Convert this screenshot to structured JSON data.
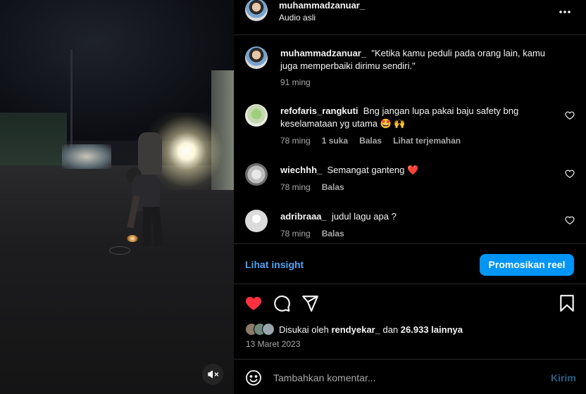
{
  "header": {
    "username": "muhammadzanuar_",
    "audio": "Audio asli",
    "more_icon": "more-horizontal-icon"
  },
  "caption": {
    "username": "muhammadzanuar_",
    "text": "\"Ketika kamu peduli pada orang lain, kamu juga memperbaiki dirimu sendiri.\"",
    "time": "91 ming"
  },
  "comments": [
    {
      "username": "refofaris_rangkuti",
      "text": "Bng jangan lupa pakai baju safety bng keselamataan yg utama 🤩 🙌",
      "time": "78 ming",
      "likes": "1 suka",
      "reply": "Balas",
      "translate": "Lihat terjemahan"
    },
    {
      "username": "wiechhh_",
      "text": "Semangat ganteng ❤️",
      "time": "78 ming",
      "reply": "Balas"
    },
    {
      "username": "adribraaa_",
      "text": "judul lagu apa ?",
      "time": "78 ming",
      "reply": "Balas"
    }
  ],
  "insight": {
    "link": "Lihat insight",
    "promote": "Promosikan reel"
  },
  "likes": {
    "prefix": "Disukai oleh",
    "user": "rendyekar_",
    "and": "dan",
    "count": "26.933 lainnya"
  },
  "date": "13 Maret 2023",
  "comment_box": {
    "placeholder": "Tambahkan komentar...",
    "post": "Kirim"
  },
  "colors": {
    "accent": "#0095f6",
    "link": "#4ea4f5",
    "liked_heart": "#ff3040",
    "muted_text": "#a8a8a8"
  },
  "icons": [
    "muted-speaker-icon",
    "heart-icon",
    "comment-icon",
    "share-icon",
    "bookmark-icon",
    "emoji-icon"
  ]
}
